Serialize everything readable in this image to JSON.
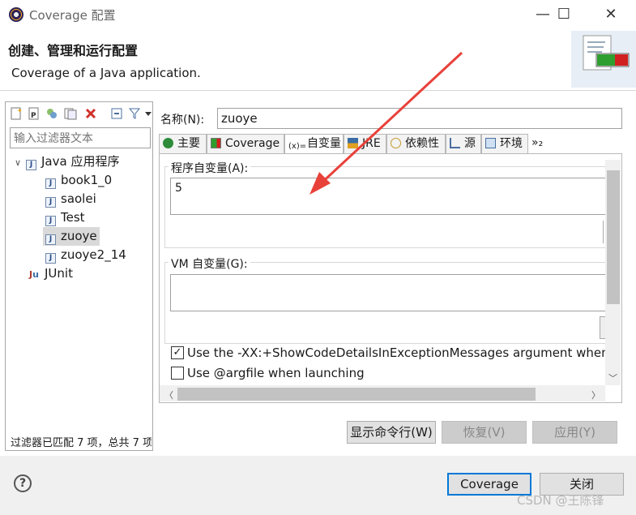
{
  "window": {
    "title": "Coverage 配置",
    "minimize": "—",
    "maximize": "☐",
    "close": "✕"
  },
  "header": {
    "title": "创建、管理和运行配置",
    "description": "Coverage of a Java application."
  },
  "left_pane": {
    "toolbar_icons": [
      "new-config-icon",
      "new-prototype-icon",
      "duplicate-icon",
      "export-icon",
      "delete-icon",
      "collapse-all-icon",
      "filter-icon",
      "view-menu-icon"
    ],
    "filter_placeholder": "输入过滤器文本",
    "tree": {
      "root": {
        "label": "Java 应用程序",
        "expand": "∨"
      },
      "children": [
        "book1_0",
        "saolei",
        "Test",
        "zuoye",
        "zuoye2_14"
      ],
      "selected": "zuoye",
      "other": "JUnit"
    },
    "status": "过滤器已匹配 7 项，总共 7 项"
  },
  "config": {
    "name_label": "名称(N):",
    "name_value": "zuoye",
    "tabs": [
      {
        "label": "主要",
        "icon": "main-icon"
      },
      {
        "label": "Coverage",
        "icon": "coverage-icon"
      },
      {
        "label": "自变量",
        "icon": "arguments-icon",
        "active": true
      },
      {
        "label": "JRE",
        "icon": "jre-icon"
      },
      {
        "label": "依赖性",
        "icon": "dependencies-icon"
      },
      {
        "label": "源",
        "icon": "source-icon"
      },
      {
        "label": "环境",
        "icon": "environment-icon"
      },
      {
        "label": "»₂",
        "icon": "more-tabs-icon"
      }
    ],
    "program_args_label": "程序自变量(A):",
    "program_args_value": "5",
    "vm_args_label": "VM 自变量(G):",
    "vm_args_value": "",
    "checkbox1_label": "Use the -XX:+ShowCodeDetailsInExceptionMessages argument when la",
    "checkbox1_checked": true,
    "checkbox2_label": "Use @argfile when launching",
    "checkbox2_checked": false
  },
  "buttons": {
    "show_cmdline": "显示命令行(W)",
    "revert": "恢复(V)",
    "apply": "应用(Y)",
    "coverage": "Coverage",
    "close": "关闭",
    "help": "?"
  },
  "watermark": "CSDN @王陈锋",
  "colors": {
    "accent": "#0078d7",
    "arrow": "#e8413a",
    "selection": "#d9d9d9"
  }
}
